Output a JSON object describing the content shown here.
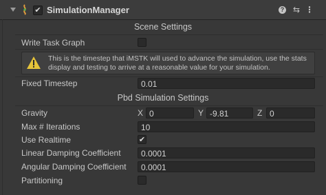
{
  "component": {
    "title": "SimulationManager",
    "enabled": true
  },
  "header_icons": {
    "help": "?",
    "presets": "⇆",
    "menu": "⋮"
  },
  "scene_settings": {
    "header": "Scene Settings",
    "write_task_graph_label": "Write Task Graph",
    "write_task_graph": false,
    "help_text": "This is the timestep that iMSTK will used to advance the simulation, use the stats display and testing to arrive at a reasonable value for your simulation.",
    "fixed_timestep_label": "Fixed Timestep",
    "fixed_timestep": "0.01"
  },
  "pbd_settings": {
    "header": "Pbd Simulation Settings",
    "gravity_label": "Gravity",
    "gravity": {
      "x_label": "X",
      "x": "0",
      "y_label": "Y",
      "y": "-9.81",
      "z_label": "Z",
      "z": "0"
    },
    "max_iterations_label": "Max # Iterations",
    "max_iterations": "10",
    "use_realtime_label": "Use Realtime",
    "use_realtime": true,
    "linear_damping_label": "Linear Damping Coefficient",
    "linear_damping": "0.0001",
    "angular_damping_label": "Angular Damping Coefficient",
    "angular_damping": "0.0001",
    "partitioning_label": "Partitioning",
    "partitioning": false
  },
  "colors": {
    "background": "#383838",
    "field": "#2a2a2a",
    "warning": "#e5c33a"
  }
}
